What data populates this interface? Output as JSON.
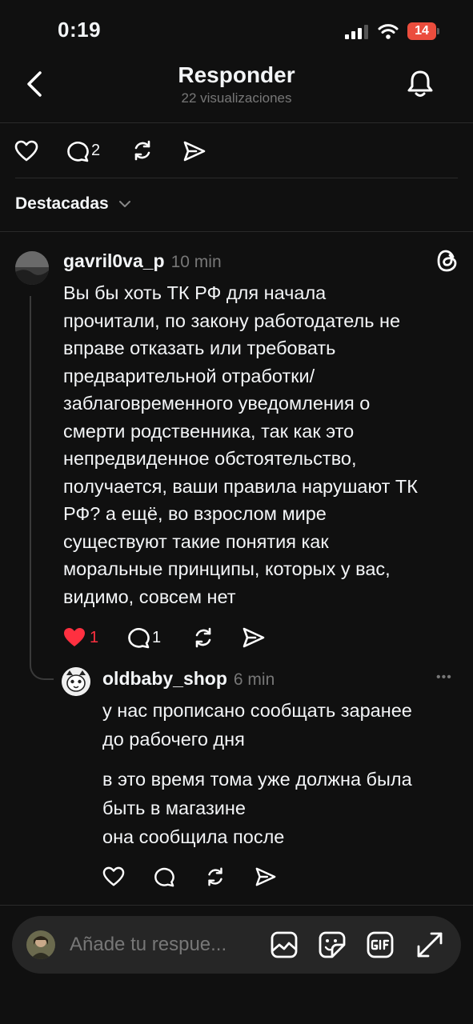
{
  "status_bar": {
    "time": "0:19",
    "battery": "14"
  },
  "header": {
    "title": "Responder",
    "subtitle": "22 visualizaciones"
  },
  "post_actions": {
    "reply_count": "2"
  },
  "sort": {
    "label": "Destacadas"
  },
  "comment": {
    "username": "gavril0va_p",
    "time": "10 min",
    "lines": [
      "Вы бы хоть ТК РФ для начала",
      "прочитали, по закону работодатель не",
      "вправе отказать или требовать",
      "предварительной отработки/",
      "заблаговременного уведомления о",
      "смерти родственника, так как это",
      "непредвиденное обстоятельство,",
      "получается, ваши правила нарушают ТК",
      "РФ? а ещё, во взрослом мире",
      "существуют такие понятия как",
      "моральные принципы, которых у вас,",
      "видимо, совсем нет"
    ],
    "like_count": "1",
    "reply_count": "1"
  },
  "reply": {
    "username": "oldbaby_shop",
    "time": "6 min",
    "more": "•••",
    "paragraph1": [
      "у нас прописано сообщать заранее",
      "до рабочего дня"
    ],
    "paragraph2": [
      "в это время тома уже должна была",
      "быть в магазине",
      "она сообщила после"
    ]
  },
  "composer": {
    "placeholder": "Añade tu respue..."
  },
  "colors": {
    "background": "#101010",
    "text": "#f3f5f7",
    "muted": "#777777",
    "like": "#ff3040",
    "battery": "#eb4d3d"
  }
}
